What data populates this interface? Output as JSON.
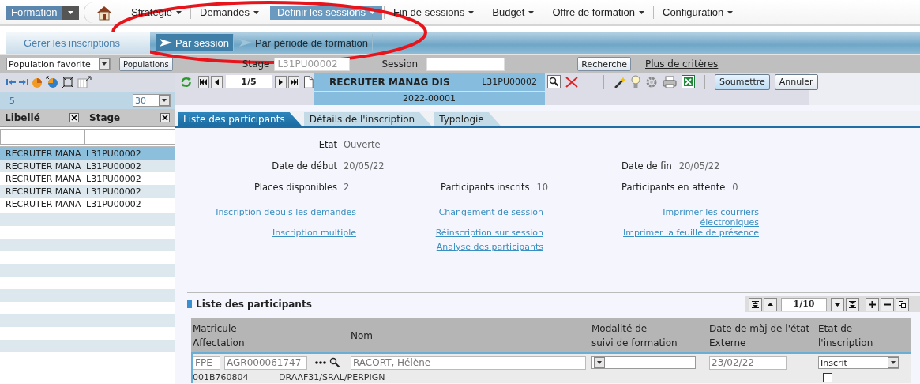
{
  "menu": {
    "module": "Formation",
    "items": [
      {
        "label": "Stratégie",
        "selected": false
      },
      {
        "label": "Demandes",
        "selected": false
      },
      {
        "label": "Définir les sessions",
        "selected": true
      },
      {
        "label": "Fin de sessions",
        "selected": false
      },
      {
        "label": "Budget",
        "selected": false
      },
      {
        "label": "Offre de formation",
        "selected": false
      },
      {
        "label": "Configuration",
        "selected": false
      }
    ]
  },
  "subtabs": {
    "main": "Gérer les inscriptions",
    "items": [
      {
        "label": "Par session",
        "selected": true
      },
      {
        "label": "Par période de formation",
        "selected": false
      }
    ]
  },
  "filters": {
    "population": "Population favorite",
    "populations_button": "Populations",
    "stage_label": "Stage",
    "stage_value": "L31PU00002",
    "session_label": "Session",
    "search_button": "Recherche",
    "more_link": "Plus de critères"
  },
  "sidebar": {
    "count": "5",
    "page_size": "30",
    "columns": [
      "Libellé",
      "Stage"
    ],
    "rows": [
      {
        "cells": [
          "RECRUTER MANA",
          "L31PU00002"
        ],
        "selected": true
      },
      {
        "cells": [
          "RECRUTER MANA",
          "L31PU00002"
        ],
        "selected": false
      },
      {
        "cells": [
          "RECRUTER MANA",
          "L31PU00002"
        ],
        "selected": false
      },
      {
        "cells": [
          "RECRUTER MANA",
          "L31PU00002"
        ],
        "selected": false
      },
      {
        "cells": [
          "RECRUTER MANA",
          "L31PU00002"
        ],
        "selected": false
      }
    ]
  },
  "record": {
    "position": "1/5",
    "title": "RECRUTER MANAG DIS",
    "code": "L31PU00002",
    "session": "2022-00001",
    "buttons": [
      "Soumettre",
      "Annuler"
    ]
  },
  "tabs": [
    {
      "label": "Liste des participants",
      "selected": true
    },
    {
      "label": "Détails de l'inscription",
      "selected": false
    },
    {
      "label": "Typologie",
      "selected": false
    }
  ],
  "fields": [
    {
      "left": {
        "label": "Etat",
        "value": "Ouverte"
      }
    },
    {
      "left": {
        "label": "Date de début",
        "value": "20/05/22"
      },
      "right": {
        "label": "Date de fin",
        "value": "20/05/22"
      }
    },
    {
      "left": {
        "label": "Places disponibles",
        "value": "2"
      },
      "middle": {
        "label": "Participants inscrits",
        "value": "10"
      },
      "right": {
        "label": "Participants en attente",
        "value": "0"
      }
    }
  ],
  "links": [
    {
      "left": "Inscription depuis les demandes",
      "middle": "Changement de session",
      "right": "Imprimer les courriers électroniques"
    },
    {
      "left": "Inscription multiple",
      "middle": "Réinscription sur session",
      "right": "Imprimer la feuille de présence"
    },
    {
      "middle": "Analyse des participants"
    }
  ],
  "participants": {
    "title": "Liste des participants",
    "pager": "1/10",
    "columns": [
      {
        "lines": [
          "Matricule",
          "Affectation"
        ]
      },
      {
        "lines": [
          "Nom"
        ]
      },
      {
        "lines": [
          "Modalité de",
          "suivi de formation"
        ]
      },
      {
        "lines": [
          "Date de màj de l'état",
          "Externe"
        ]
      },
      {
        "lines": [
          "Etat de",
          "l'inscription"
        ]
      }
    ],
    "rows": [
      {
        "corps": "FPE",
        "matricule": "AGR000061747",
        "name": "RACORT, Hélène",
        "date": "23/02/22",
        "external": false,
        "state": "Inscrit",
        "code": "001B760804",
        "affectation": "DRAAF31/SRAL/PERPIGN"
      }
    ]
  },
  "annotations": [
    {
      "kind": "ellipse"
    }
  ]
}
